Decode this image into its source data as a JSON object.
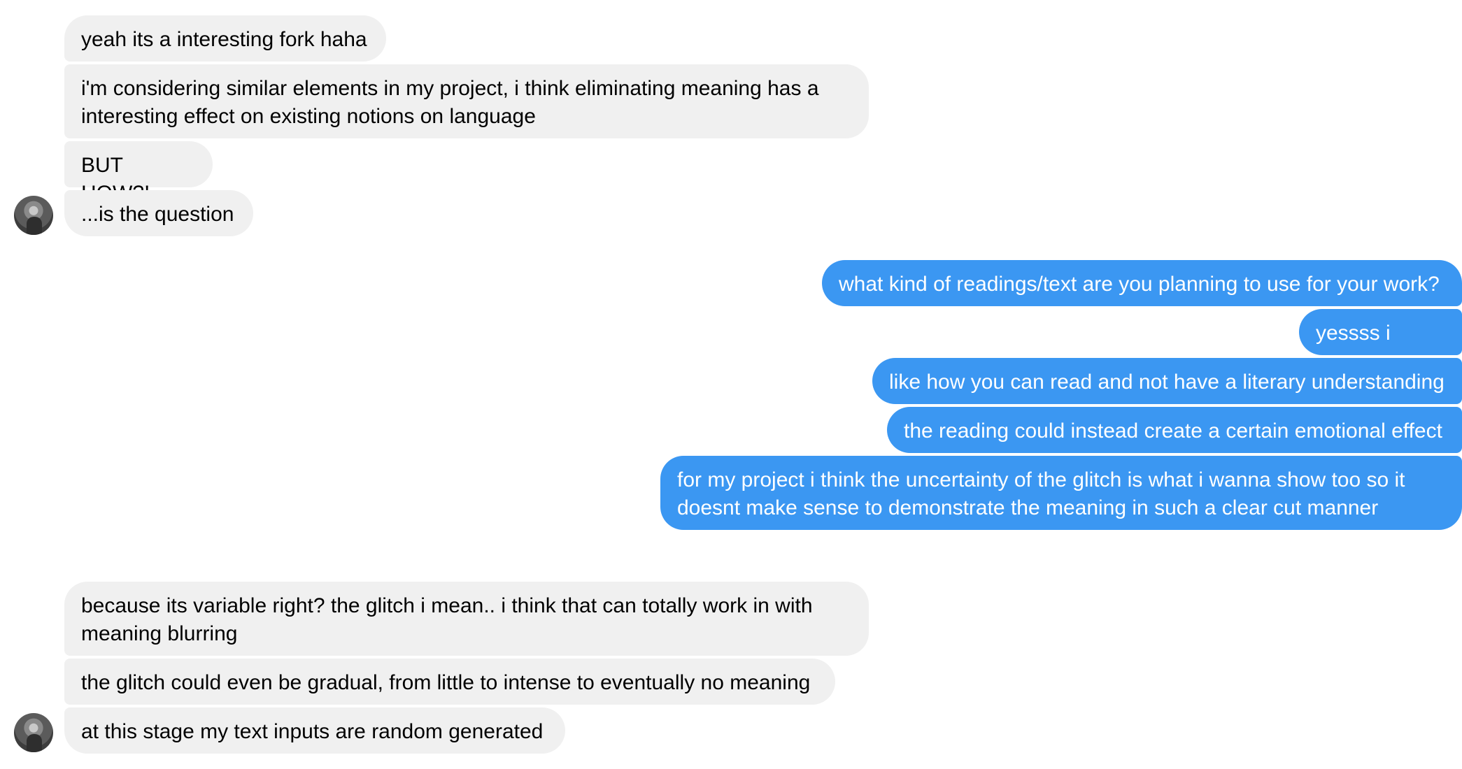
{
  "conversation": {
    "messages": [
      {
        "sender": "them",
        "text": "yeah its a interesting fork haha"
      },
      {
        "sender": "them",
        "text": "i'm considering similar elements in my project, i think eliminating meaning has a interesting effect on existing notions on language"
      },
      {
        "sender": "them",
        "text": "BUT HOW?!"
      },
      {
        "sender": "them",
        "text": "...is the question"
      },
      {
        "sender": "me",
        "text": "what kind of readings/text are you planning to use for your work?"
      },
      {
        "sender": "me",
        "text": "yessss i agree"
      },
      {
        "sender": "me",
        "text": "like how you can read and not have a literary understanding"
      },
      {
        "sender": "me",
        "text": "the reading could instead create a certain emotional effect"
      },
      {
        "sender": "me",
        "text": "for my project i think the uncertainty of the glitch is what i wanna show too so it doesnt make sense to demonstrate the meaning in such a clear cut manner"
      },
      {
        "sender": "them",
        "text": "because its variable right? the glitch i mean.. i think that can totally work in with meaning blurring"
      },
      {
        "sender": "them",
        "text": "the glitch could even be gradual, from little to intense to eventually no meaning"
      },
      {
        "sender": "them",
        "text": "at this stage my text inputs are random generated"
      }
    ]
  },
  "colors": {
    "incoming_bubble": "#f0f0f0",
    "incoming_text": "#000000",
    "outgoing_bubble": "#3b97f2",
    "outgoing_text": "#ffffff",
    "background": "#ffffff"
  },
  "icons": {
    "avatar": "contact-avatar-photo"
  }
}
